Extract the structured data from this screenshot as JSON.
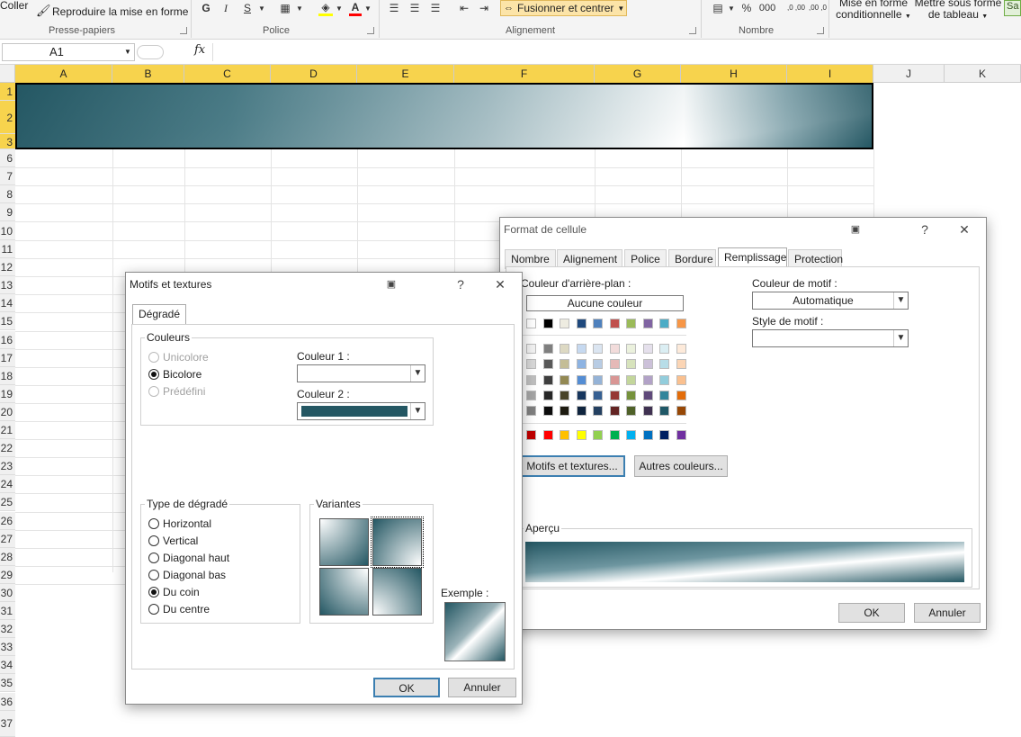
{
  "ribbon": {
    "coller": "Coller",
    "reproduire": "Reproduire la mise en forme",
    "bold": "G",
    "italic": "I",
    "underline": "S",
    "fusionner": "Fusionner et centrer",
    "percent": "%",
    "thousands": "000",
    "dec_inc": ",0 ,00",
    "dec_dec": ",00 ,0",
    "mise_en_forme_1": "Mise en forme",
    "mise_en_forme_2": "conditionnelle",
    "mettre_sous_forme_1": "Mettre sous forme",
    "mettre_sous_forme_2": "de tableau",
    "sa": "Sa",
    "groups": {
      "presse_papiers": "Presse-papiers",
      "police": "Police",
      "alignement": "Alignement",
      "nombre": "Nombre"
    }
  },
  "formula_bar": {
    "name_box": "A1",
    "fx": "fx",
    "value": ""
  },
  "sheet": {
    "columns": [
      "A",
      "B",
      "C",
      "D",
      "E",
      "F",
      "G",
      "H",
      "I",
      "J",
      "K"
    ],
    "rows": [
      "1",
      "2",
      "3",
      "6",
      "7",
      "8",
      "9",
      "10",
      "11",
      "12",
      "13",
      "14",
      "15",
      "16",
      "17",
      "18",
      "19",
      "20",
      "21",
      "22",
      "23",
      "24",
      "25",
      "26",
      "27",
      "28",
      "29",
      "30",
      "31",
      "32",
      "33",
      "34",
      "35",
      "36",
      "37"
    ]
  },
  "format_dialog": {
    "title": "Format de cellule",
    "help": "?",
    "close": "✕",
    "tabs": [
      "Nombre",
      "Alignement",
      "Police",
      "Bordure",
      "Remplissage",
      "Protection"
    ],
    "active_tab": "Remplissage",
    "bg_color_label": "Couleur d'arrière-plan :",
    "no_color": "Aucune couleur",
    "pattern_color_label": "Couleur de motif :",
    "pattern_color_value": "Automatique",
    "pattern_style_label": "Style de motif :",
    "pattern_style_value": "",
    "motifs_button": "Motifs et textures...",
    "autres_button": "Autres couleurs...",
    "apercu_label": "Aperçu",
    "ok": "OK",
    "cancel": "Annuler",
    "theme_row": [
      "#ffffff",
      "#000000",
      "#eeece1",
      "#1f497d",
      "#4f81bd",
      "#c0504d",
      "#9bbb59",
      "#8064a2",
      "#4bacc6",
      "#f79646"
    ],
    "tint_rows": [
      [
        "#f2f2f2",
        "#7f7f7f",
        "#ddd9c3",
        "#c6d9f0",
        "#dbe5f1",
        "#f2dcdb",
        "#ebf1dd",
        "#e5e0ec",
        "#dbeef3",
        "#fdeada"
      ],
      [
        "#d8d8d8",
        "#595959",
        "#c4bd97",
        "#8db3e2",
        "#b8cce4",
        "#e5b9b7",
        "#d7e3bc",
        "#ccc1d9",
        "#b7dde8",
        "#fbd5b5"
      ],
      [
        "#bfbfbf",
        "#3f3f3f",
        "#938953",
        "#548dd4",
        "#95b3d7",
        "#d99694",
        "#c3d69b",
        "#b2a2c7",
        "#92cddc",
        "#fac08f"
      ],
      [
        "#a5a5a5",
        "#262626",
        "#494429",
        "#17365d",
        "#366092",
        "#953734",
        "#76923c",
        "#5f497a",
        "#31859b",
        "#e36c09"
      ],
      [
        "#7f7f7f",
        "#0c0c0c",
        "#1d1b10",
        "#0f243e",
        "#244061",
        "#632423",
        "#4f6128",
        "#3f3151",
        "#205867",
        "#974806"
      ]
    ],
    "standard_row": [
      "#c00000",
      "#ff0000",
      "#ffc000",
      "#ffff00",
      "#92d050",
      "#00b050",
      "#00b0f0",
      "#0070c0",
      "#002060",
      "#7030a0"
    ]
  },
  "motifs_dialog": {
    "title": "Motifs et textures",
    "help": "?",
    "close": "✕",
    "tab": "Dégradé",
    "couleurs_label": "Couleurs",
    "unicolore": "Unicolore",
    "bicolore": "Bicolore",
    "predefini": "Prédéfini",
    "couleur1_label": "Couleur 1 :",
    "couleur2_label": "Couleur 2 :",
    "couleur1": "#ffffff",
    "couleur2": "#245763",
    "type_label": "Type de dégradé",
    "types": [
      "Horizontal",
      "Vertical",
      "Diagonal haut",
      "Diagonal bas",
      "Du coin",
      "Du centre"
    ],
    "selected_type": "Du coin",
    "variantes_label": "Variantes",
    "exemple_label": "Exemple :",
    "ok": "OK",
    "cancel": "Annuler"
  }
}
